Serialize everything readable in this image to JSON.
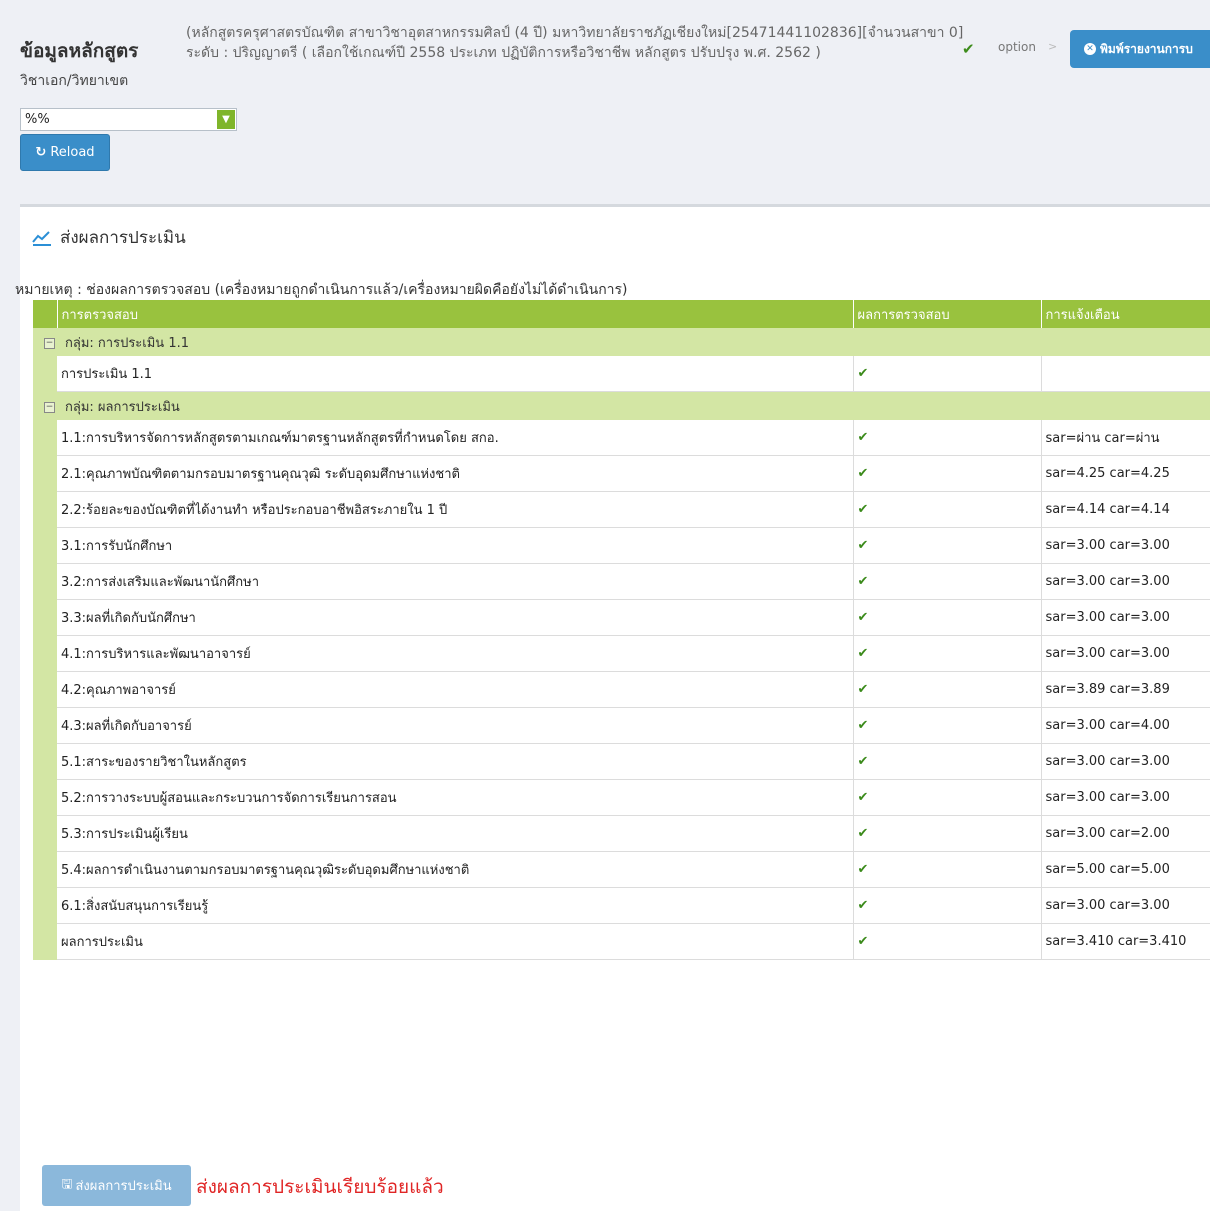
{
  "header": {
    "title": "ข้อมูลหลักสูตร",
    "description_line1": "(หลักสูตรครุศาสตรบัณฑิต สาขาวิชาอุตสาหกรรมศิลป์ (4 ปี) มหาวิทยาลัยราชภัฏเชียงใหม่[25471441102836][จำนวนสาขา 0]",
    "description_line2": "ระดับ : ปริญญาตรี ( เลือกใช้เกณฑ์ปี 2558 ประเภท ปฏิบัติการหรือวิชาชีพ หลักสูตร ปรับปรุง พ.ศ. 2562 )",
    "option_label": "option",
    "print_button": "พิมพ์รายงานการบ"
  },
  "filter": {
    "major_label": "วิชาเอก/วิทยาเขต",
    "select_value": "%%",
    "reload_label": "Reload"
  },
  "panel": {
    "title": "ส่งผลการประเมิน",
    "note": "หมายเหตุ : ช่องผลการตรวจสอบ (เครื่องหมายถูกดำเนินการแล้ว/เครื่องหมายผิดคือยังไม่ได้ดำเนินการ)"
  },
  "table": {
    "columns": [
      "การตรวจสอบ",
      "ผลการตรวจสอบ",
      "การแจ้งเตือน"
    ],
    "groups": [
      {
        "label": "กลุ่ม: การประเมิน 1.1",
        "rows": [
          {
            "name": "การประเมิน 1.1",
            "check": "✔",
            "alert": ""
          }
        ]
      },
      {
        "label": "กลุ่ม: ผลการประเมิน",
        "rows": [
          {
            "name": "1.1:การบริหารจัดการหลักสูตรตามเกณฑ์มาตรฐานหลักสูตรที่กำหนดโดย สกอ.",
            "check": "✔",
            "alert": "sar=ผ่าน car=ผ่าน"
          },
          {
            "name": "2.1:คุณภาพบัณฑิตตามกรอบมาตรฐานคุณวุฒิ ระดับอุดมศึกษาแห่งชาติ",
            "check": "✔",
            "alert": "sar=4.25 car=4.25"
          },
          {
            "name": "2.2:ร้อยละของบัณฑิตที่ได้งานทำ หรือประกอบอาชีพอิสระภายใน 1 ปี",
            "check": "✔",
            "alert": "sar=4.14 car=4.14"
          },
          {
            "name": "3.1:การรับนักศึกษา",
            "check": "✔",
            "alert": "sar=3.00 car=3.00"
          },
          {
            "name": "3.2:การส่งเสริมและพัฒนานักศึกษา",
            "check": "✔",
            "alert": "sar=3.00 car=3.00"
          },
          {
            "name": "3.3:ผลที่เกิดกับนักศึกษา",
            "check": "✔",
            "alert": "sar=3.00 car=3.00"
          },
          {
            "name": "4.1:การบริหารและพัฒนาอาจารย์",
            "check": "✔",
            "alert": "sar=3.00 car=3.00"
          },
          {
            "name": "4.2:คุณภาพอาจารย์",
            "check": "✔",
            "alert": "sar=3.89 car=3.89"
          },
          {
            "name": "4.3:ผลที่เกิดกับอาจารย์",
            "check": "✔",
            "alert": "sar=3.00 car=4.00"
          },
          {
            "name": "5.1:สาระของรายวิชาในหลักสูตร",
            "check": "✔",
            "alert": "sar=3.00 car=3.00"
          },
          {
            "name": "5.2:การวางระบบผู้สอนและกระบวนการจัดการเรียนการสอน",
            "check": "✔",
            "alert": "sar=3.00 car=3.00"
          },
          {
            "name": "5.3:การประเมินผู้เรียน",
            "check": "✔",
            "alert": "sar=3.00 car=2.00"
          },
          {
            "name": "5.4:ผลการดำเนินงานตามกรอบมาตรฐานคุณวุฒิระดับอุดมศึกษาแห่งชาติ",
            "check": "✔",
            "alert": "sar=5.00 car=5.00"
          },
          {
            "name": "6.1:สิ่งสนับสนุนการเรียนรู้",
            "check": "✔",
            "alert": "sar=3.00 car=3.00"
          },
          {
            "name": "ผลการประเมิน",
            "check": "✔",
            "alert": "sar=3.410 car=3.410"
          }
        ]
      }
    ]
  },
  "footer": {
    "submit_label": "ส่งผลการประเมิน",
    "submit_message": "ส่งผลการประเมินเรียบร้อยแล้ว"
  },
  "colors": {
    "header_green": "#99c23e",
    "group_green": "#d3e6a4",
    "button_blue": "#3a8ec9",
    "check_green": "#3a8a1a",
    "message_red": "#e02525"
  }
}
